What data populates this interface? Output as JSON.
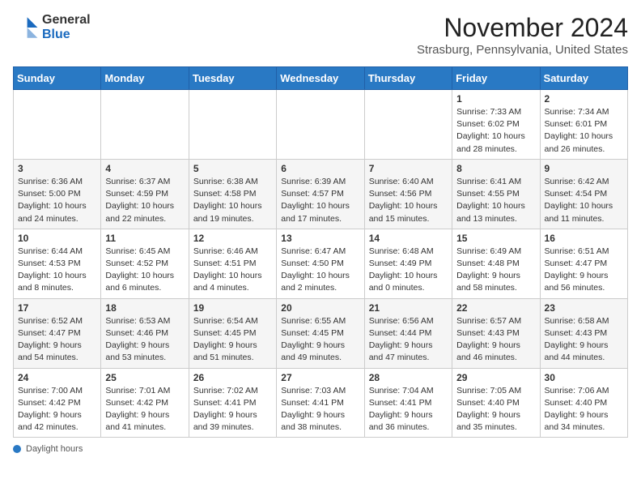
{
  "header": {
    "logo_general": "General",
    "logo_blue": "Blue",
    "month": "November 2024",
    "location": "Strasburg, Pennsylvania, United States"
  },
  "weekdays": [
    "Sunday",
    "Monday",
    "Tuesday",
    "Wednesday",
    "Thursday",
    "Friday",
    "Saturday"
  ],
  "weeks": [
    [
      {
        "day": "",
        "info": ""
      },
      {
        "day": "",
        "info": ""
      },
      {
        "day": "",
        "info": ""
      },
      {
        "day": "",
        "info": ""
      },
      {
        "day": "",
        "info": ""
      },
      {
        "day": "1",
        "info": "Sunrise: 7:33 AM\nSunset: 6:02 PM\nDaylight: 10 hours and 28 minutes."
      },
      {
        "day": "2",
        "info": "Sunrise: 7:34 AM\nSunset: 6:01 PM\nDaylight: 10 hours and 26 minutes."
      }
    ],
    [
      {
        "day": "3",
        "info": "Sunrise: 6:36 AM\nSunset: 5:00 PM\nDaylight: 10 hours and 24 minutes."
      },
      {
        "day": "4",
        "info": "Sunrise: 6:37 AM\nSunset: 4:59 PM\nDaylight: 10 hours and 22 minutes."
      },
      {
        "day": "5",
        "info": "Sunrise: 6:38 AM\nSunset: 4:58 PM\nDaylight: 10 hours and 19 minutes."
      },
      {
        "day": "6",
        "info": "Sunrise: 6:39 AM\nSunset: 4:57 PM\nDaylight: 10 hours and 17 minutes."
      },
      {
        "day": "7",
        "info": "Sunrise: 6:40 AM\nSunset: 4:56 PM\nDaylight: 10 hours and 15 minutes."
      },
      {
        "day": "8",
        "info": "Sunrise: 6:41 AM\nSunset: 4:55 PM\nDaylight: 10 hours and 13 minutes."
      },
      {
        "day": "9",
        "info": "Sunrise: 6:42 AM\nSunset: 4:54 PM\nDaylight: 10 hours and 11 minutes."
      }
    ],
    [
      {
        "day": "10",
        "info": "Sunrise: 6:44 AM\nSunset: 4:53 PM\nDaylight: 10 hours and 8 minutes."
      },
      {
        "day": "11",
        "info": "Sunrise: 6:45 AM\nSunset: 4:52 PM\nDaylight: 10 hours and 6 minutes."
      },
      {
        "day": "12",
        "info": "Sunrise: 6:46 AM\nSunset: 4:51 PM\nDaylight: 10 hours and 4 minutes."
      },
      {
        "day": "13",
        "info": "Sunrise: 6:47 AM\nSunset: 4:50 PM\nDaylight: 10 hours and 2 minutes."
      },
      {
        "day": "14",
        "info": "Sunrise: 6:48 AM\nSunset: 4:49 PM\nDaylight: 10 hours and 0 minutes."
      },
      {
        "day": "15",
        "info": "Sunrise: 6:49 AM\nSunset: 4:48 PM\nDaylight: 9 hours and 58 minutes."
      },
      {
        "day": "16",
        "info": "Sunrise: 6:51 AM\nSunset: 4:47 PM\nDaylight: 9 hours and 56 minutes."
      }
    ],
    [
      {
        "day": "17",
        "info": "Sunrise: 6:52 AM\nSunset: 4:47 PM\nDaylight: 9 hours and 54 minutes."
      },
      {
        "day": "18",
        "info": "Sunrise: 6:53 AM\nSunset: 4:46 PM\nDaylight: 9 hours and 53 minutes."
      },
      {
        "day": "19",
        "info": "Sunrise: 6:54 AM\nSunset: 4:45 PM\nDaylight: 9 hours and 51 minutes."
      },
      {
        "day": "20",
        "info": "Sunrise: 6:55 AM\nSunset: 4:45 PM\nDaylight: 9 hours and 49 minutes."
      },
      {
        "day": "21",
        "info": "Sunrise: 6:56 AM\nSunset: 4:44 PM\nDaylight: 9 hours and 47 minutes."
      },
      {
        "day": "22",
        "info": "Sunrise: 6:57 AM\nSunset: 4:43 PM\nDaylight: 9 hours and 46 minutes."
      },
      {
        "day": "23",
        "info": "Sunrise: 6:58 AM\nSunset: 4:43 PM\nDaylight: 9 hours and 44 minutes."
      }
    ],
    [
      {
        "day": "24",
        "info": "Sunrise: 7:00 AM\nSunset: 4:42 PM\nDaylight: 9 hours and 42 minutes."
      },
      {
        "day": "25",
        "info": "Sunrise: 7:01 AM\nSunset: 4:42 PM\nDaylight: 9 hours and 41 minutes."
      },
      {
        "day": "26",
        "info": "Sunrise: 7:02 AM\nSunset: 4:41 PM\nDaylight: 9 hours and 39 minutes."
      },
      {
        "day": "27",
        "info": "Sunrise: 7:03 AM\nSunset: 4:41 PM\nDaylight: 9 hours and 38 minutes."
      },
      {
        "day": "28",
        "info": "Sunrise: 7:04 AM\nSunset: 4:41 PM\nDaylight: 9 hours and 36 minutes."
      },
      {
        "day": "29",
        "info": "Sunrise: 7:05 AM\nSunset: 4:40 PM\nDaylight: 9 hours and 35 minutes."
      },
      {
        "day": "30",
        "info": "Sunrise: 7:06 AM\nSunset: 4:40 PM\nDaylight: 9 hours and 34 minutes."
      }
    ]
  ],
  "footer": {
    "daylight_label": "Daylight hours"
  }
}
